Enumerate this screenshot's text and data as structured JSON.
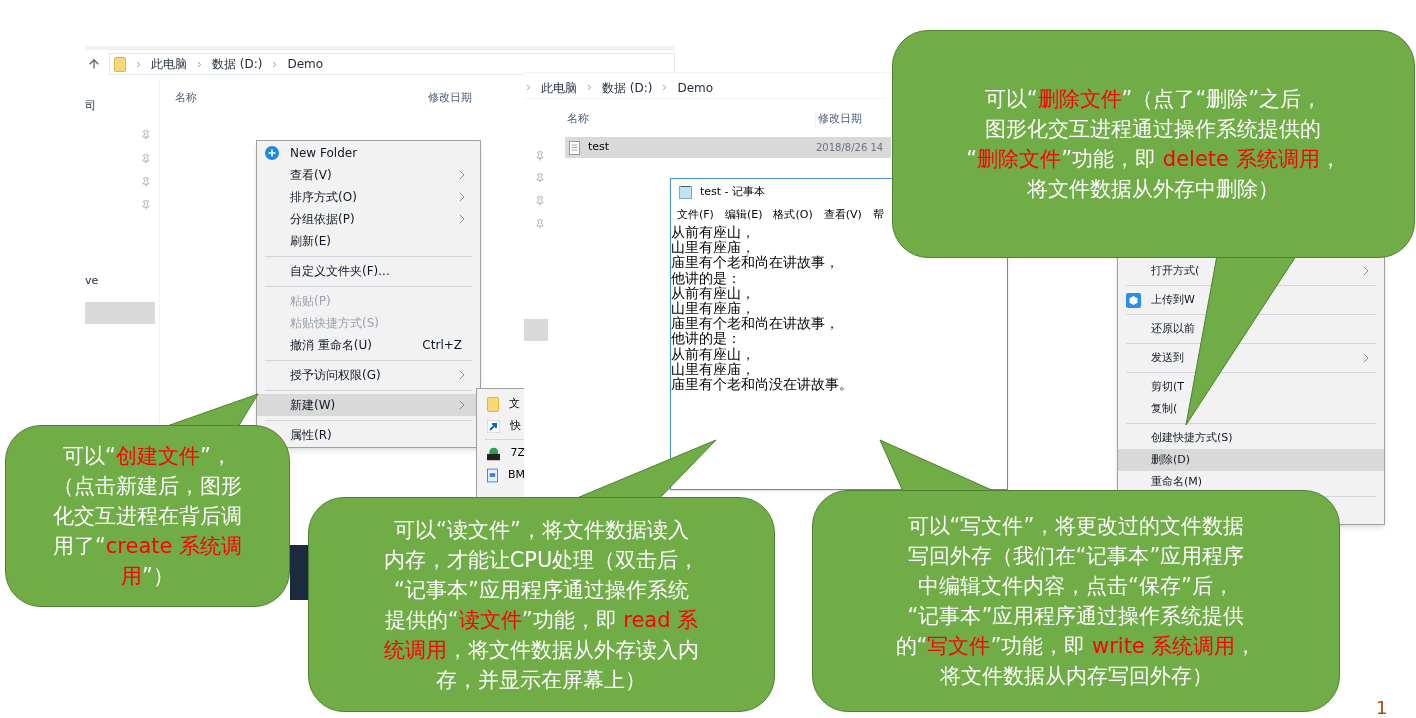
{
  "explorer_left": {
    "breadcrumb": [
      "此电脑",
      "数据 (D:)",
      "Demo"
    ],
    "columns": [
      "名称",
      "修改日期"
    ],
    "sidebar_fragments": [
      "司",
      "ve"
    ],
    "context_menu": [
      {
        "kind": "icon_item",
        "label": "New Folder",
        "submenu": false,
        "disabled": false,
        "selected": false
      },
      {
        "kind": "item",
        "label": "查看(V)",
        "submenu": true,
        "disabled": false,
        "selected": false
      },
      {
        "kind": "item",
        "label": "排序方式(O)",
        "submenu": true,
        "disabled": false,
        "selected": false
      },
      {
        "kind": "item",
        "label": "分组依据(P)",
        "submenu": true,
        "disabled": false,
        "selected": false
      },
      {
        "kind": "item",
        "label": "刷新(E)",
        "submenu": false,
        "disabled": false,
        "selected": false
      },
      {
        "kind": "separator"
      },
      {
        "kind": "item",
        "label": "自定义文件夹(F)...",
        "submenu": false,
        "disabled": false,
        "selected": false
      },
      {
        "kind": "separator"
      },
      {
        "kind": "item",
        "label": "粘贴(P)",
        "submenu": false,
        "disabled": true,
        "selected": false
      },
      {
        "kind": "item",
        "label": "粘贴快捷方式(S)",
        "submenu": false,
        "disabled": true,
        "selected": false
      },
      {
        "kind": "item",
        "label": "撤消 重命名(U)",
        "shortcut": "Ctrl+Z",
        "submenu": false,
        "disabled": false,
        "selected": false
      },
      {
        "kind": "separator"
      },
      {
        "kind": "item",
        "label": "授予访问权限(G)",
        "submenu": true,
        "disabled": false,
        "selected": false
      },
      {
        "kind": "separator"
      },
      {
        "kind": "item",
        "label": "新建(W)",
        "submenu": true,
        "disabled": false,
        "selected": true
      },
      {
        "kind": "separator"
      },
      {
        "kind": "item",
        "label": "属性(R)",
        "submenu": false,
        "disabled": false,
        "selected": false
      }
    ],
    "new_submenu": [
      {
        "kind": "folder",
        "label": "文"
      },
      {
        "kind": "shortcut",
        "label": "快"
      },
      {
        "kind": "separator"
      },
      {
        "kind": "archive",
        "label": "7Z"
      },
      {
        "kind": "image",
        "label": "BM"
      }
    ]
  },
  "explorer_right": {
    "breadcrumb": [
      "此电脑",
      "数据 (D:)",
      "Demo"
    ],
    "columns": [
      "名称",
      "修改日期"
    ],
    "files": [
      {
        "name": "test",
        "date": "2018/8/26 14",
        "selected": true
      }
    ]
  },
  "notepad": {
    "title": "test - 记事本",
    "menu": [
      "文件(F)",
      "编辑(E)",
      "格式(O)",
      "查看(V)",
      "帮"
    ],
    "lines": [
      "从前有座山，",
      "山里有座庙，",
      "庙里有个老和尚在讲故事，",
      "他讲的是：",
      "从前有座山，",
      "山里有座庙，",
      "庙里有个老和尚在讲故事，",
      "他讲的是：",
      "从前有座山，",
      "山里有座庙，",
      "庙里有个老和尚没在讲故事。"
    ]
  },
  "file_context_menu": [
    {
      "kind": "item",
      "label": "打开方式(",
      "submenu": true,
      "selected": false
    },
    {
      "kind": "separator"
    },
    {
      "kind": "icon_item",
      "label": "上传到W",
      "submenu": false,
      "selected": false
    },
    {
      "kind": "separator"
    },
    {
      "kind": "item",
      "label": "还原以前",
      "submenu": false,
      "selected": false
    },
    {
      "kind": "separator"
    },
    {
      "kind": "item",
      "label": "发送到",
      "submenu": true,
      "selected": false
    },
    {
      "kind": "separator"
    },
    {
      "kind": "item",
      "label": "剪切(T",
      "submenu": false,
      "selected": false
    },
    {
      "kind": "item",
      "label": "复制(",
      "submenu": false,
      "selected": false
    },
    {
      "kind": "separator"
    },
    {
      "kind": "item",
      "label": "创建快捷方式(S)",
      "submenu": false,
      "selected": false
    },
    {
      "kind": "item",
      "label": "删除(D)",
      "submenu": false,
      "selected": true
    },
    {
      "kind": "item",
      "label": "重命名(M)",
      "submenu": false,
      "selected": false
    },
    {
      "kind": "separator"
    }
  ],
  "callouts": [
    {
      "lines": [
        [
          {
            "t": "可以“"
          },
          {
            "t": "删除文件",
            "red": true
          },
          {
            "t": "”（点了“删除”之后，"
          }
        ],
        [
          {
            "t": "图形化交互进程通过操作系统提供的"
          }
        ],
        [
          {
            "t": "“"
          },
          {
            "t": "删除文件",
            "red": true
          },
          {
            "t": "”功能，即 "
          },
          {
            "t": "delete 系统调用",
            "red": true
          },
          {
            "t": "，"
          }
        ],
        [
          {
            "t": "将文件数据从外存中删除）"
          }
        ]
      ]
    },
    {
      "lines": [
        [
          {
            "t": "可以“"
          },
          {
            "t": "创建文件",
            "red": true
          },
          {
            "t": "”，"
          }
        ],
        [
          {
            "t": "（点击新建后，图形"
          }
        ],
        [
          {
            "t": "化交互进程在背后调"
          }
        ],
        [
          {
            "t": "用了“"
          },
          {
            "t": "create 系统调",
            "red": true
          }
        ],
        [
          {
            "t": "用",
            "red": true
          },
          {
            "t": "”）"
          }
        ]
      ]
    },
    {
      "lines": [
        [
          {
            "t": "可以“读文件”，将文件数据读入"
          }
        ],
        [
          {
            "t": "内存，才能让CPU处理（双击后，"
          }
        ],
        [
          {
            "t": "“记事本”应用程序通过操作系统"
          }
        ],
        [
          {
            "t": "提供的“"
          },
          {
            "t": "读文件",
            "red": true
          },
          {
            "t": "”功能，即 "
          },
          {
            "t": "read 系",
            "red": true
          }
        ],
        [
          {
            "t": "统调用",
            "red": true
          },
          {
            "t": "，将文件数据从外存读入内"
          }
        ],
        [
          {
            "t": "存，并显示在屏幕上）"
          }
        ]
      ]
    },
    {
      "lines": [
        [
          {
            "t": "可以“写文件”，将更改过的文件数据"
          }
        ],
        [
          {
            "t": "写回外存（我们在“记事本”应用程序"
          }
        ],
        [
          {
            "t": "中编辑文件内容，点击“保存”后，"
          }
        ],
        [
          {
            "t": "“记事本”应用程序通过操作系统提供"
          }
        ],
        [
          {
            "t": "的“"
          },
          {
            "t": "写文件",
            "red": true
          },
          {
            "t": "”功能，即 "
          },
          {
            "t": "write 系统调用",
            "red": true
          },
          {
            "t": "，"
          }
        ],
        [
          {
            "t": "将文件数据从内存写回外存）"
          }
        ]
      ]
    }
  ],
  "page_number": "1"
}
